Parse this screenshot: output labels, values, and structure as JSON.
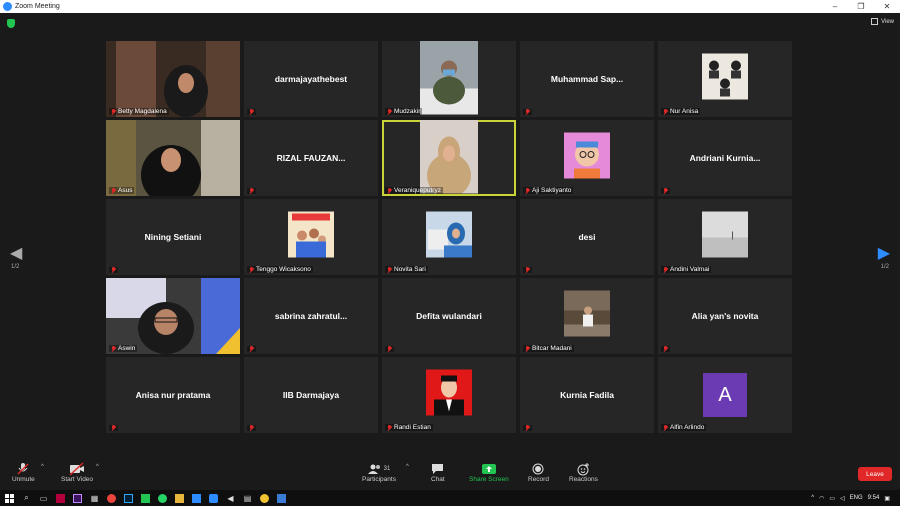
{
  "window": {
    "title": "Zoom Meeting",
    "minimize": "–",
    "maximize": "❐",
    "close": "✕"
  },
  "header": {
    "view_label": "View"
  },
  "pagination": {
    "left": "1/2",
    "right": "1/2"
  },
  "tiles": [
    {
      "label": "Betty Magdalena",
      "big": "",
      "photo": "woman-hijab-room"
    },
    {
      "label": "",
      "big": "darmajayathebest"
    },
    {
      "label": "Mudzakir",
      "big": "",
      "photo": "man-mask-office"
    },
    {
      "label": "",
      "big": "Muhammad  Sap..."
    },
    {
      "label": "Nur Anisa",
      "big": "",
      "photo": "group-photo"
    },
    {
      "label": "Asus",
      "big": "",
      "photo": "girl-hijab"
    },
    {
      "label": "",
      "big": "RIZAL  FAUZAN..."
    },
    {
      "label": "Veraniqueputryz",
      "big": "",
      "photo": "woman-hijab-beige",
      "active": true
    },
    {
      "label": "Aji Saktiyanto",
      "big": "",
      "photo": "cartoon-avatar"
    },
    {
      "label": "",
      "big": "Andriani  Kurnia..."
    },
    {
      "label": "",
      "big": "Nining Setiani"
    },
    {
      "label": "Tenggo Wicaksono",
      "big": "",
      "photo": "family-photo"
    },
    {
      "label": "Novita Sari",
      "big": "",
      "photo": "woman-laptop"
    },
    {
      "label": "",
      "big": "desi"
    },
    {
      "label": "Andini Valmai",
      "big": "",
      "photo": "sea-fog"
    },
    {
      "label": "Aswin",
      "big": "",
      "photo": "woman-glasses"
    },
    {
      "label": "",
      "big": "sabrina  zahratul..."
    },
    {
      "label": "",
      "big": "Defita wulandari"
    },
    {
      "label": "Bitcar Madani",
      "big": "",
      "photo": "man-outdoor"
    },
    {
      "label": "",
      "big": "Alia yan's novita"
    },
    {
      "label": "",
      "big": "Anisa nur pratama"
    },
    {
      "label": "",
      "big": "IIB Darmajaya"
    },
    {
      "label": "Randi Estian",
      "big": "",
      "photo": "id-photo-red"
    },
    {
      "label": "",
      "big": "Kurnia Fadila"
    },
    {
      "label": "Alfin Arlindo",
      "big": "",
      "photo": "letter-avatar",
      "avatar_letter": "A"
    }
  ],
  "toolbar": {
    "unmute": "Unmute",
    "start_video": "Start Video",
    "participants": "Participants",
    "participants_count": "31",
    "chat": "Chat",
    "share_screen": "Share Screen",
    "record": "Record",
    "reactions": "Reactions",
    "leave": "Leave"
  },
  "taskbar": {
    "language": "ENG",
    "time": "9:54"
  },
  "colors": {
    "accent": "#2d8cff",
    "share": "#23c552",
    "leave": "#e02828",
    "active_border": "#c8d43a",
    "avatar_bg": "#6b3bb4"
  }
}
